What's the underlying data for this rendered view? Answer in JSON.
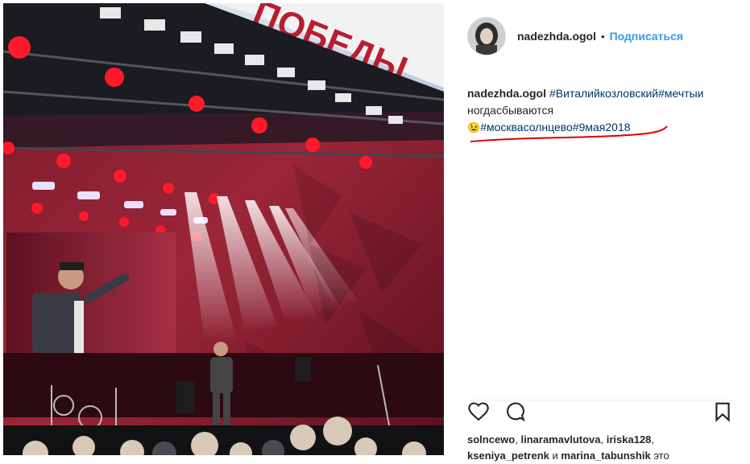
{
  "post": {
    "username": "nadezhda.ogol",
    "separator": "•",
    "follow_label": "Подписаться",
    "photo": {
      "banner_text": "ПОБЕДЫ"
    },
    "caption": {
      "user": "nadezhda.ogol",
      "line1_tags": "#Виталийкозловский#мечтыи",
      "line2": "ногдасбываются",
      "emoji": "😉",
      "tag_moscow": "#москвасолнцево",
      "tag_date": "#9мая2018"
    },
    "likes": {
      "u1": "solncewo",
      "sep1": ",",
      "u2": "linaramavlutova",
      "sep2": ",",
      "u3": "iriska128",
      "sep3": ",",
      "u4": "kseniya_petrenk",
      "and_text": "и",
      "u5": "marina_tabunshik",
      "tail": "это"
    },
    "icons": {
      "like": "heart-icon",
      "comment": "comment-icon",
      "save": "bookmark-icon"
    },
    "colors": {
      "link": "#3897f0",
      "hashtag": "#003569",
      "annotation": "#e00000"
    }
  }
}
